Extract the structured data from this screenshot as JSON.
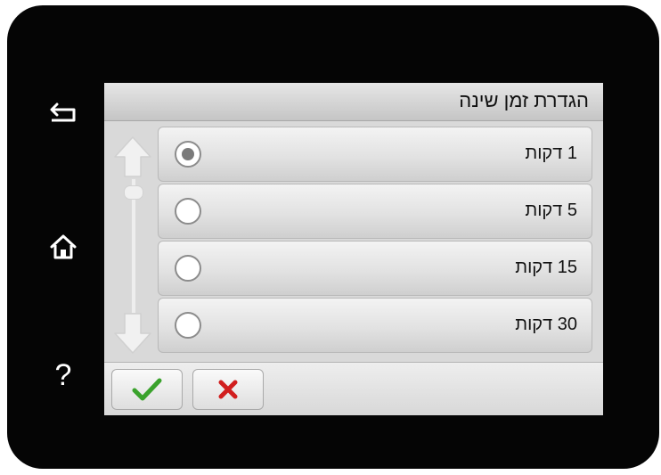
{
  "device": {
    "side_buttons": [
      {
        "icon": "back-arrow-icon"
      },
      {
        "icon": "home-icon"
      },
      {
        "icon": "help-icon",
        "glyph": "?"
      }
    ]
  },
  "header": {
    "title": "הגדרת זמן שינה"
  },
  "options": [
    {
      "label": "1 דקות",
      "selected": true
    },
    {
      "label": "5 דקות",
      "selected": false
    },
    {
      "label": "15 דקות",
      "selected": false
    },
    {
      "label": "30 דקות",
      "selected": false
    }
  ],
  "footer": {
    "ok_icon": "checkmark-icon",
    "ok_color": "#3aa22c",
    "cancel_icon": "close-icon",
    "cancel_color": "#d11e1e"
  },
  "colors": {
    "device_bezel": "#050505",
    "radio_selected_dot": "#7a7a7a"
  }
}
